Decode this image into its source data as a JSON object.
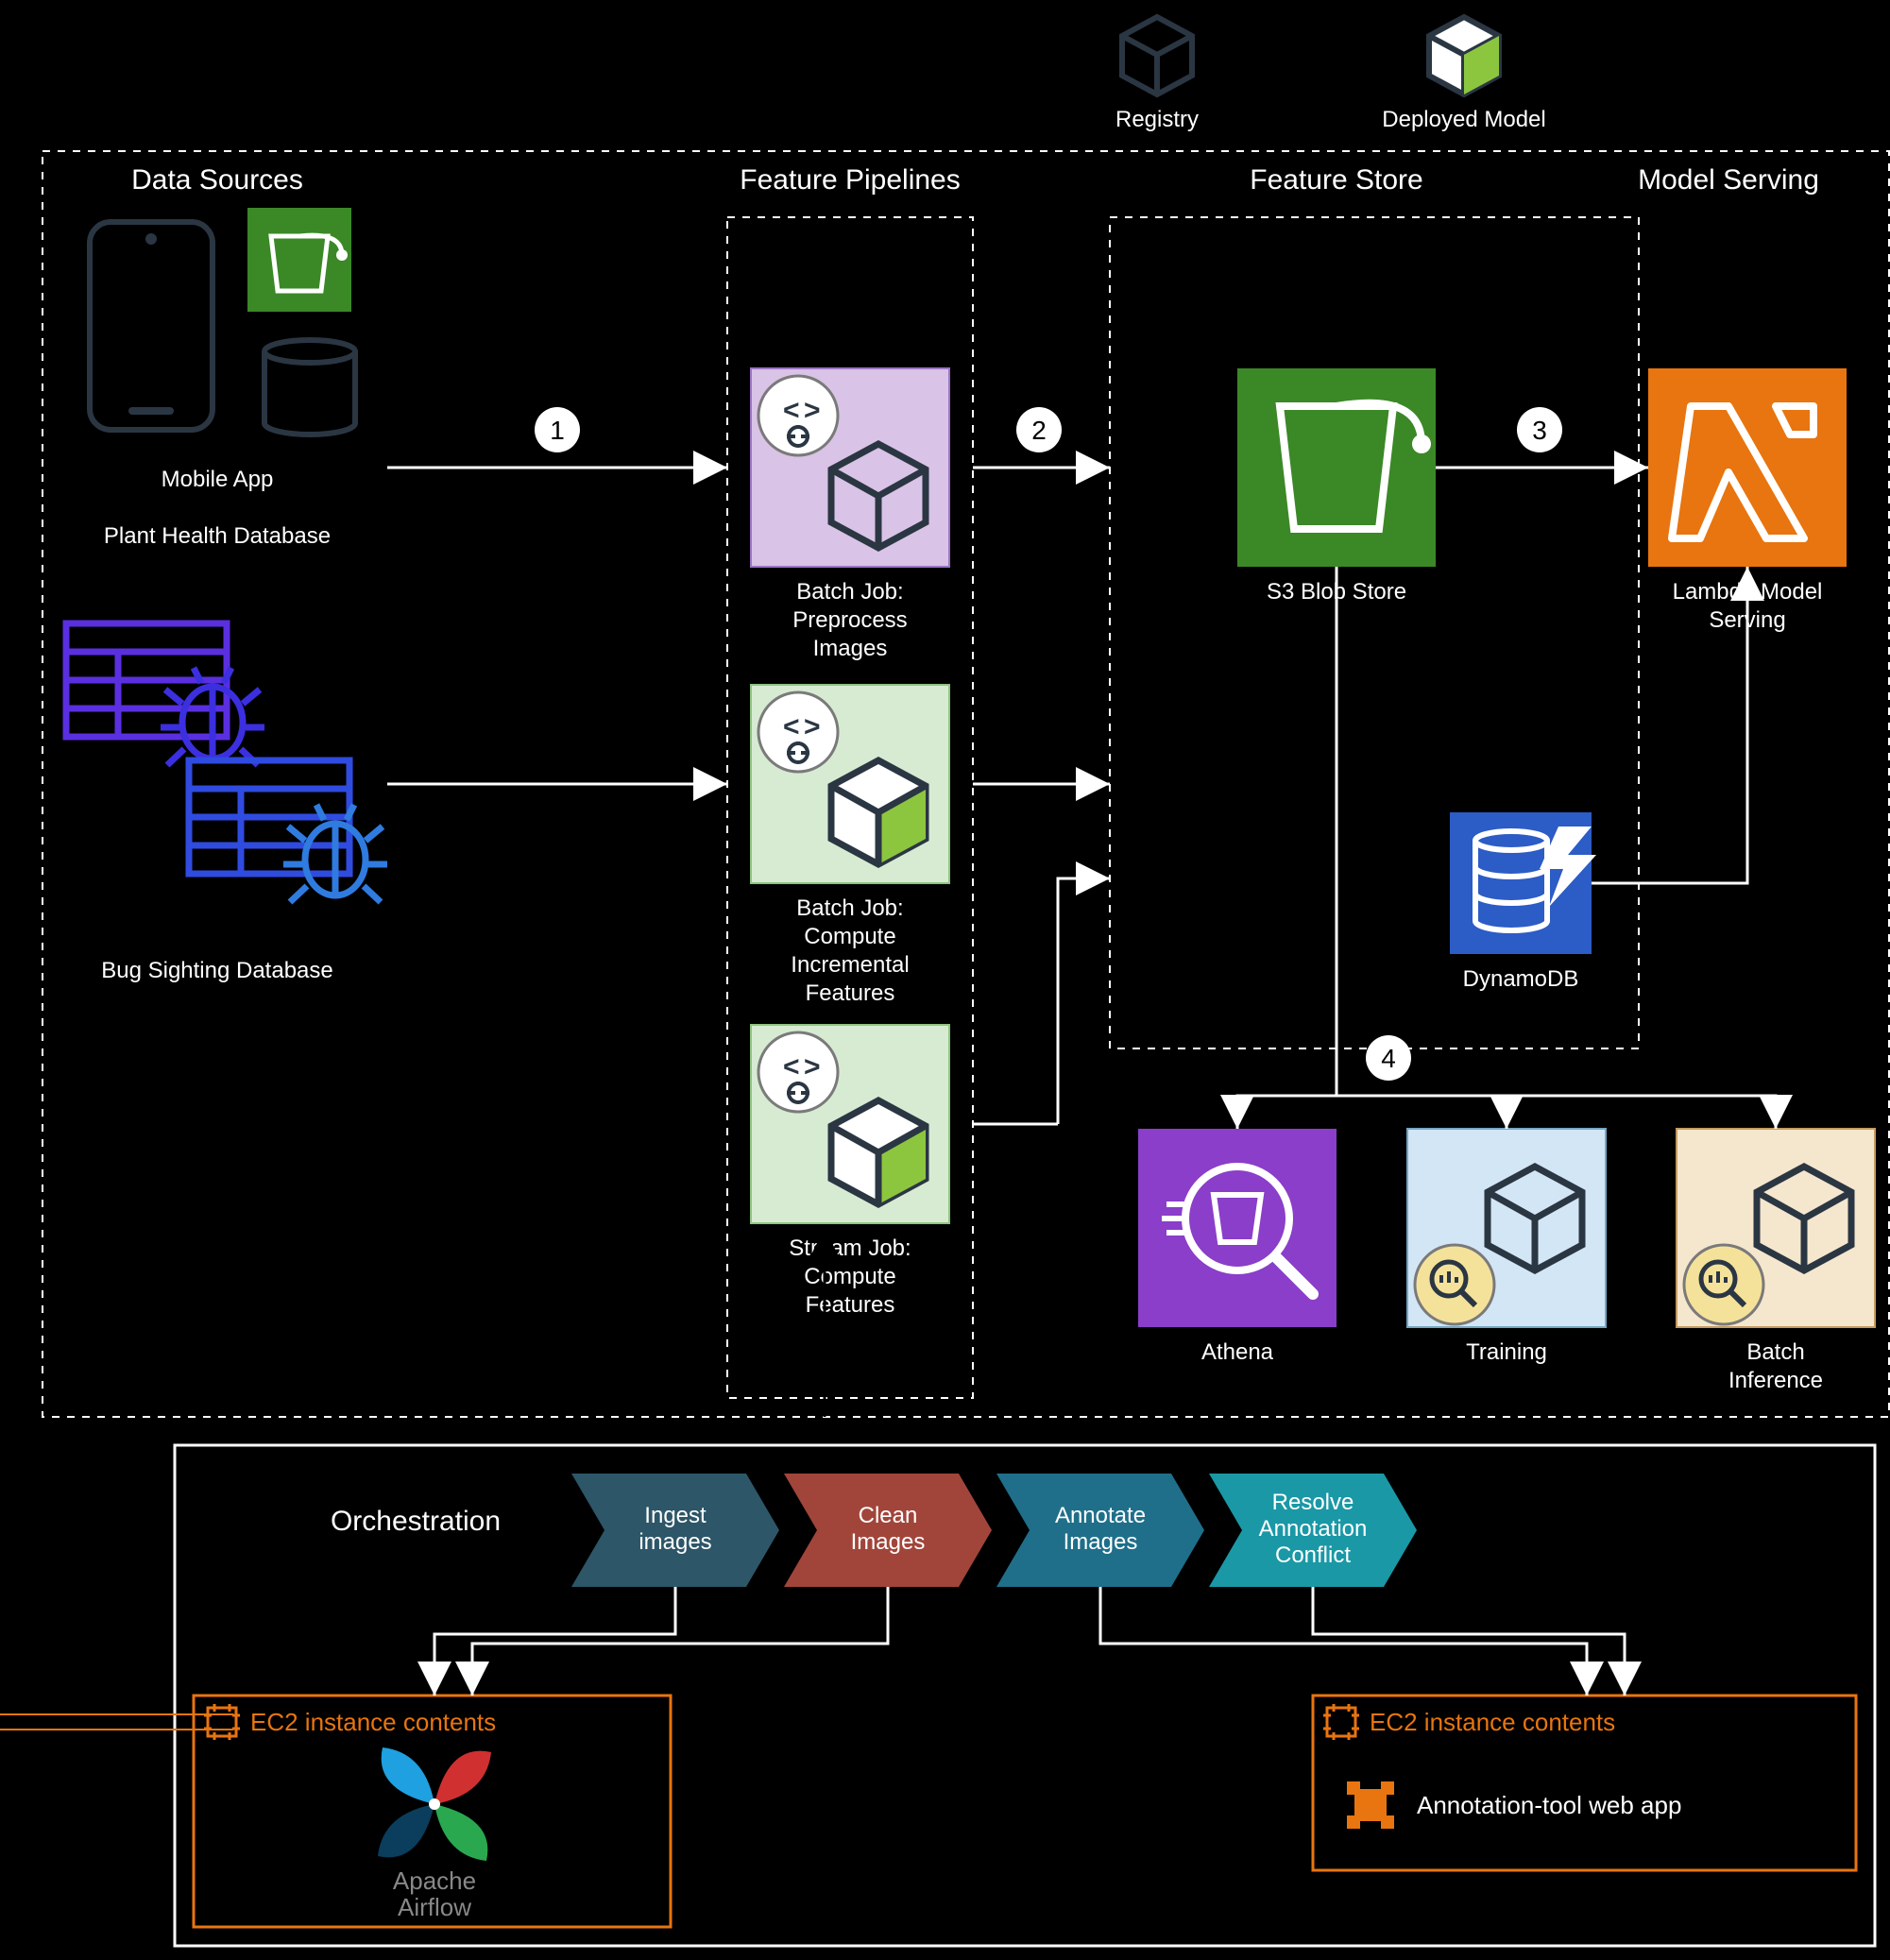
{
  "legend": {
    "registry": "Registry",
    "deployed": "Deployed Model"
  },
  "columns": {
    "sources": "Data Sources",
    "pipelines": "Feature Pipelines",
    "store": "Feature Store",
    "serving": "Model Serving"
  },
  "sources": {
    "mobile": "Mobile App",
    "healthDb": "Plant Health Database",
    "bugDb": "Bug Sighting Database"
  },
  "pipelines": {
    "batch": {
      "t1": "Batch Job:",
      "t2": "Preprocess",
      "t3": "Images"
    },
    "incr": {
      "t1": "Batch Job:",
      "t2": "Compute",
      "t3": "Incremental",
      "t4": "Features"
    },
    "stream": {
      "t1": "Stream Job:",
      "t2": "Compute",
      "t3": "Features"
    }
  },
  "store": {
    "s3": "S3 Blob Store",
    "dynamo": "DynamoDB"
  },
  "serving": {
    "lambda": {
      "t1": "Lambda Model",
      "t2": "Serving"
    },
    "athena": "Athena",
    "training": "Training",
    "batchInf": {
      "t1": "Batch",
      "t2": "Inference"
    }
  },
  "numbers": {
    "n1": "1",
    "n2": "2",
    "n3": "3",
    "n4": "4"
  },
  "orchestration": {
    "title": "Orchestration",
    "steps": {
      "s1a": "Ingest",
      "s1b": "images",
      "s2a": "Clean",
      "s2b": "Images",
      "s3a": "Annotate",
      "s3b": "Images",
      "s4a": "Resolve",
      "s4b": "Annotation",
      "s4c": "Conflict"
    }
  },
  "ec2": {
    "left": {
      "title": "EC2 instance contents",
      "apache": "Apache",
      "airflow": "Airflow"
    },
    "right": {
      "title": "EC2 instance contents",
      "line": "Annotation-tool web app"
    }
  }
}
